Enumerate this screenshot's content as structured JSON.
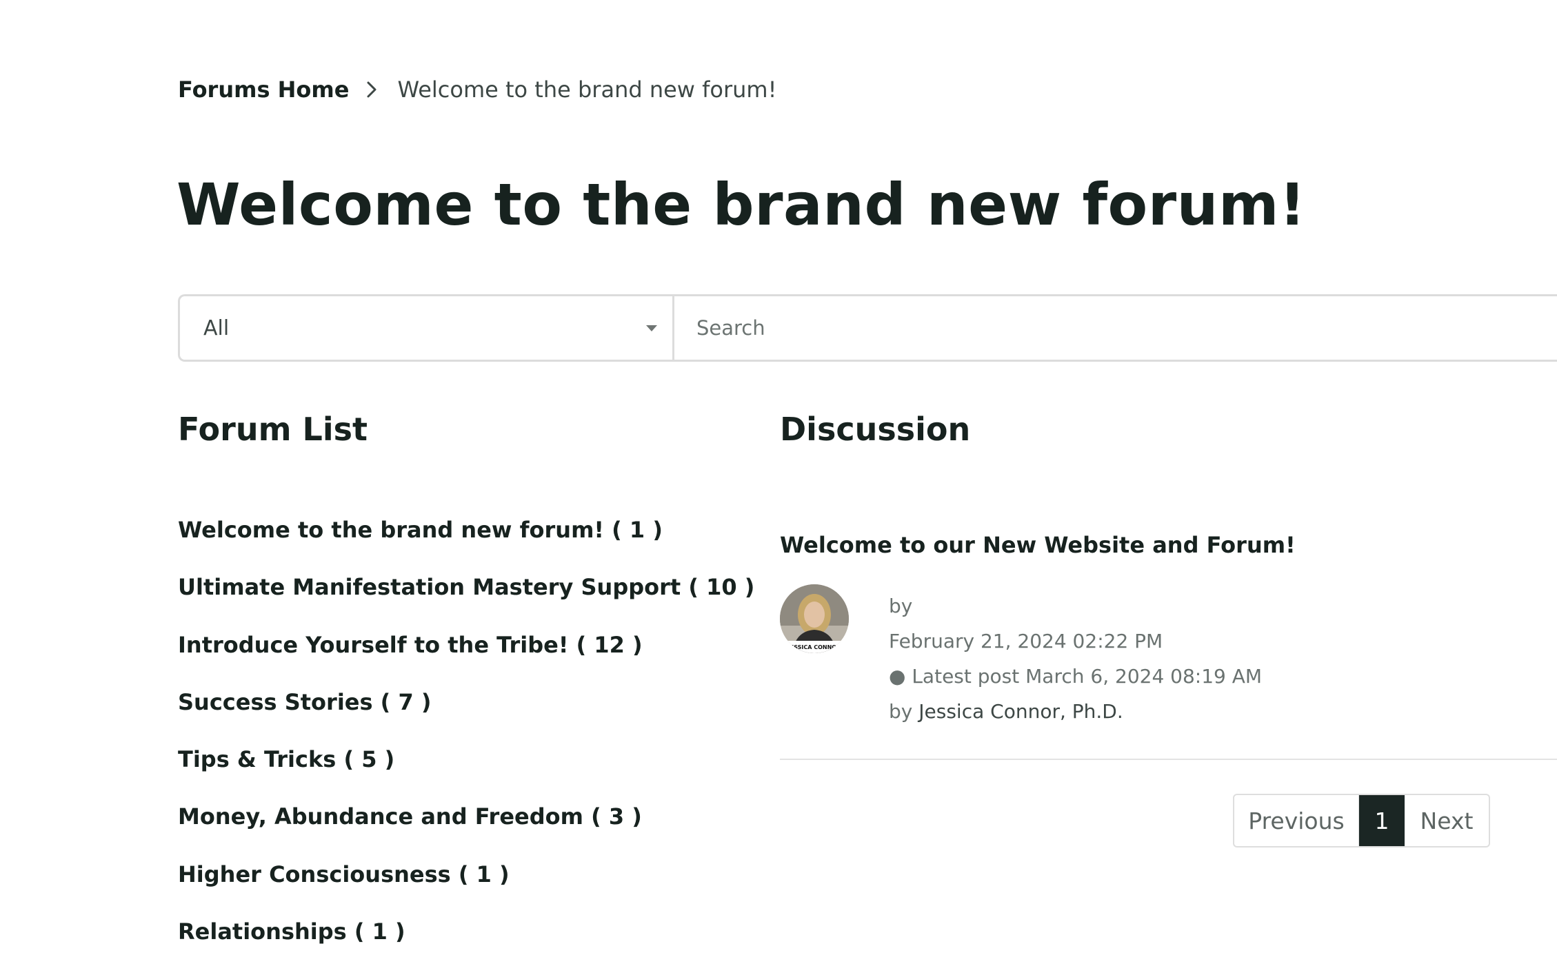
{
  "breadcrumb": {
    "home": "Forums Home",
    "current": "Welcome to the brand new forum!"
  },
  "page_title": "Welcome to the brand new forum!",
  "search": {
    "filter_value": "All",
    "placeholder": "Search"
  },
  "forum_list": {
    "heading": "Forum List",
    "items": [
      "Welcome to the brand new forum! ( 1 )",
      "Ultimate Manifestation Mastery Support ( 10 )",
      "Introduce Yourself to the Tribe! ( 12 )",
      "Success Stories ( 7 )",
      "Tips & Tricks ( 5 )",
      "Money, Abundance and Freedom ( 3 )",
      "Higher Consciousness ( 1 )",
      "Relationships ( 1 )"
    ]
  },
  "discussion": {
    "heading": "Discussion",
    "topic": {
      "title": "Welcome to our New Website and Forum!",
      "by_label": "by",
      "created": "February 21, 2024 02:22 PM",
      "latest_post": "● Latest post March 6, 2024 08:19 AM",
      "latest_by_label": "by",
      "latest_author": "Jessica Connor, Ph.D.",
      "avatar_caption": "JESSICA CONNOR"
    }
  },
  "pagination": {
    "previous": "Previous",
    "current_page": "1",
    "next": "Next"
  },
  "colors": {
    "text_dark": "#17221f",
    "text_muted": "#6a7270",
    "active_page_bg": "#1b2624",
    "border": "#dcdcdc"
  }
}
